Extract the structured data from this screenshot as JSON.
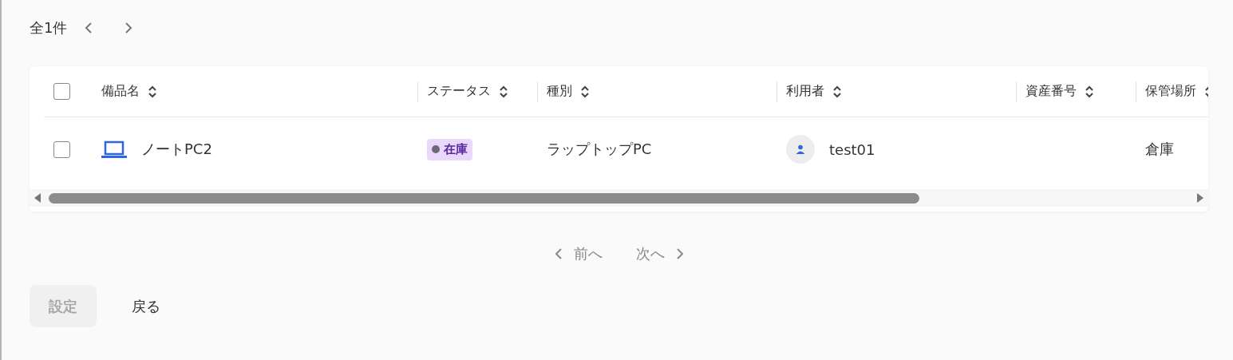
{
  "result_count": "全1件",
  "table": {
    "header_checkbox": {
      "checked": false
    },
    "columns": [
      {
        "label": "備品名",
        "sortable": true
      },
      {
        "label": "ステータス",
        "sortable": true
      },
      {
        "label": "種別",
        "sortable": true
      },
      {
        "label": "利用者",
        "sortable": true
      },
      {
        "label": "資産番号",
        "sortable": true
      },
      {
        "label": "保管場所",
        "sortable": true
      }
    ],
    "rows": [
      {
        "checked": false,
        "name": "ノートPC2",
        "status": {
          "label": "在庫",
          "color": "#e9d8fb"
        },
        "type": "ラップトップPC",
        "user": "test01",
        "location": "倉庫"
      }
    ]
  },
  "pager": {
    "prev": {
      "label": "前へ",
      "disabled": true
    },
    "next": {
      "label": "次へ",
      "disabled": true
    }
  },
  "buttons": [
    {
      "label": "設定",
      "kind": "primary",
      "disabled": true
    },
    {
      "label": "戻る",
      "kind": "text",
      "disabled": false
    }
  ]
}
